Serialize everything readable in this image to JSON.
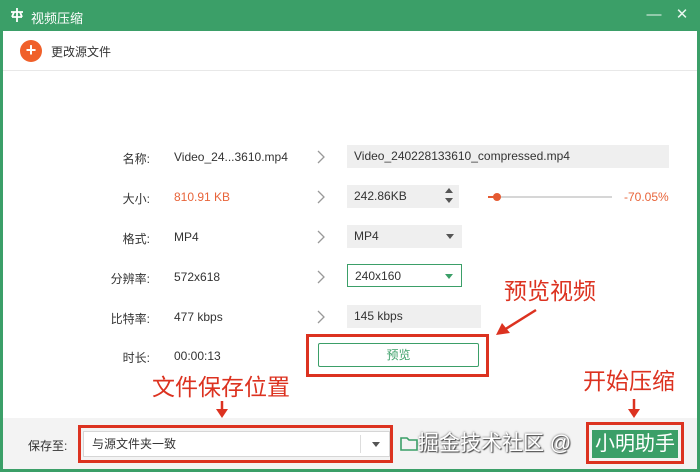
{
  "window": {
    "title": "视频压缩",
    "minimize_glyph": "—",
    "close_glyph": "✕"
  },
  "toolbar": {
    "change_source_label": "更改源文件"
  },
  "rows": {
    "name": {
      "label": "名称:",
      "original": "Video_24...3610.mp4",
      "output": "Video_240228133610_compressed.mp4"
    },
    "size": {
      "label": "大小:",
      "original": "810.91 KB",
      "output": "242.86KB",
      "percent": "-70.05%",
      "slider_level": 0.07
    },
    "format": {
      "label": "格式:",
      "original": "MP4",
      "output": "MP4"
    },
    "resolution": {
      "label": "分辨率:",
      "original": "572x618",
      "output": "240x160"
    },
    "bitrate": {
      "label": "比特率:",
      "original": "477 kbps",
      "output": "145 kbps"
    },
    "duration": {
      "label": "时长:",
      "original": "00:00:13"
    }
  },
  "preview_button": "预览",
  "annotations": {
    "preview_video": "预览视频",
    "save_location": "文件保存位置",
    "start_compress": "开始压缩"
  },
  "bottom": {
    "save_to_label": "保存至:",
    "save_to_value": "与源文件夹一致",
    "watermark": "掘金技术社区 @",
    "start_button": "小明助手"
  },
  "colors": {
    "brand_green": "#3b9f68",
    "accent_orange": "#f0602a",
    "annotation_red": "#dc3220"
  }
}
